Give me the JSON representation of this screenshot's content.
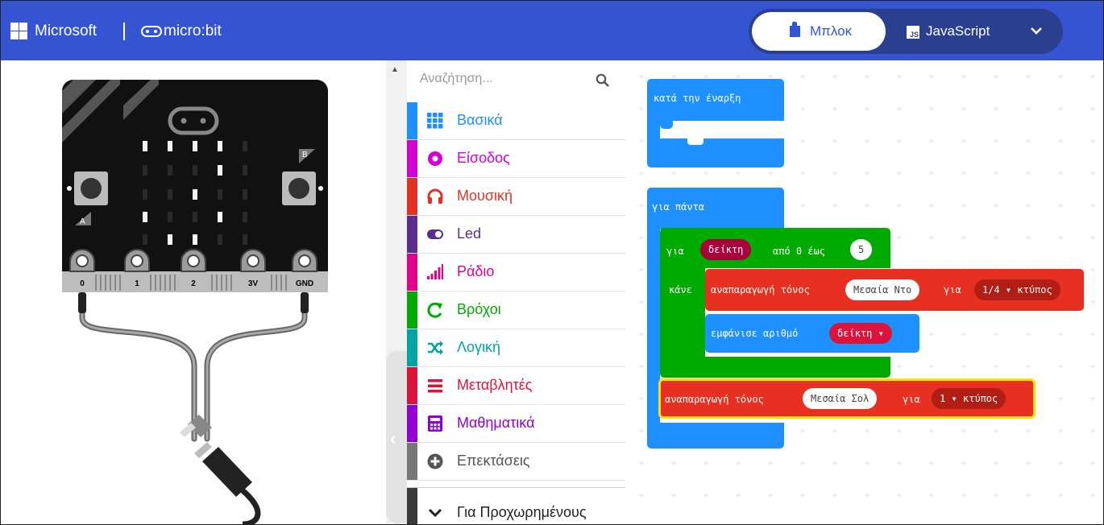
{
  "header": {
    "microsoft_label": "Microsoft",
    "product_label": "micro:bit",
    "blocks_label": "Μπλοκ",
    "js_badge": "JS",
    "javascript_label": "JavaScript"
  },
  "simulator": {
    "button_a": "A",
    "button_b": "B",
    "pins": [
      "0",
      "1",
      "2",
      "3V",
      "GND"
    ]
  },
  "toolbox": {
    "search_placeholder": "Αναζήτηση...",
    "categories": [
      {
        "label": "Βασικά",
        "color": "#1e90ff",
        "icon": "grid-icon"
      },
      {
        "label": "Είσοδος",
        "color": "#d400d4",
        "icon": "input-circle-icon"
      },
      {
        "label": "Μουσική",
        "color": "#e63022",
        "icon": "headphones-icon"
      },
      {
        "label": "Led",
        "color": "#5c2d91",
        "icon": "toggle-icon"
      },
      {
        "label": "Ράδιο",
        "color": "#e3008c",
        "icon": "signal-bars-icon"
      },
      {
        "label": "Βρόχοι",
        "color": "#00aa00",
        "icon": "loop-arrow-icon"
      },
      {
        "label": "Λογική",
        "color": "#00a4a6",
        "icon": "shuffle-icon"
      },
      {
        "label": "Μεταβλητές",
        "color": "#dc143c",
        "icon": "lines-icon"
      },
      {
        "label": "Μαθηματικά",
        "color": "#9400d3",
        "icon": "calculator-icon"
      },
      {
        "label": "Επεκτάσεις",
        "color": "#777777",
        "icon": "plus-circle-icon"
      }
    ],
    "advanced_label": "Για Προχωρημένους"
  },
  "workspace": {
    "on_start": {
      "label": "κατά την έναρξη",
      "color": "#1e90ff"
    },
    "forever": {
      "label": "για πάντα",
      "color": "#1e90ff"
    },
    "for_loop": {
      "for_label": "για",
      "var_label": "δείκτη",
      "range_label": "από 0 έως",
      "end_value": "5",
      "do_label": "κάνε",
      "color": "#00aa00"
    },
    "play_tone_1": {
      "prefix": "αναπαραγωγή τόνος",
      "note": "Μεσαία Ντο",
      "for_label": "για",
      "beat": "1/4 ▾ κτύπος",
      "color": "#e63022"
    },
    "show_number": {
      "label": "εμφάνισε αριθμό",
      "var": "δείκτη ▾",
      "color": "#1e90ff"
    },
    "play_tone_2": {
      "prefix": "αναπαραγωγή τόνος",
      "note": "Μεσαία Σολ",
      "for_label": "για",
      "beat": "1 ▾ κτύπος",
      "color": "#e63022",
      "highlight": "#ffe000"
    }
  }
}
